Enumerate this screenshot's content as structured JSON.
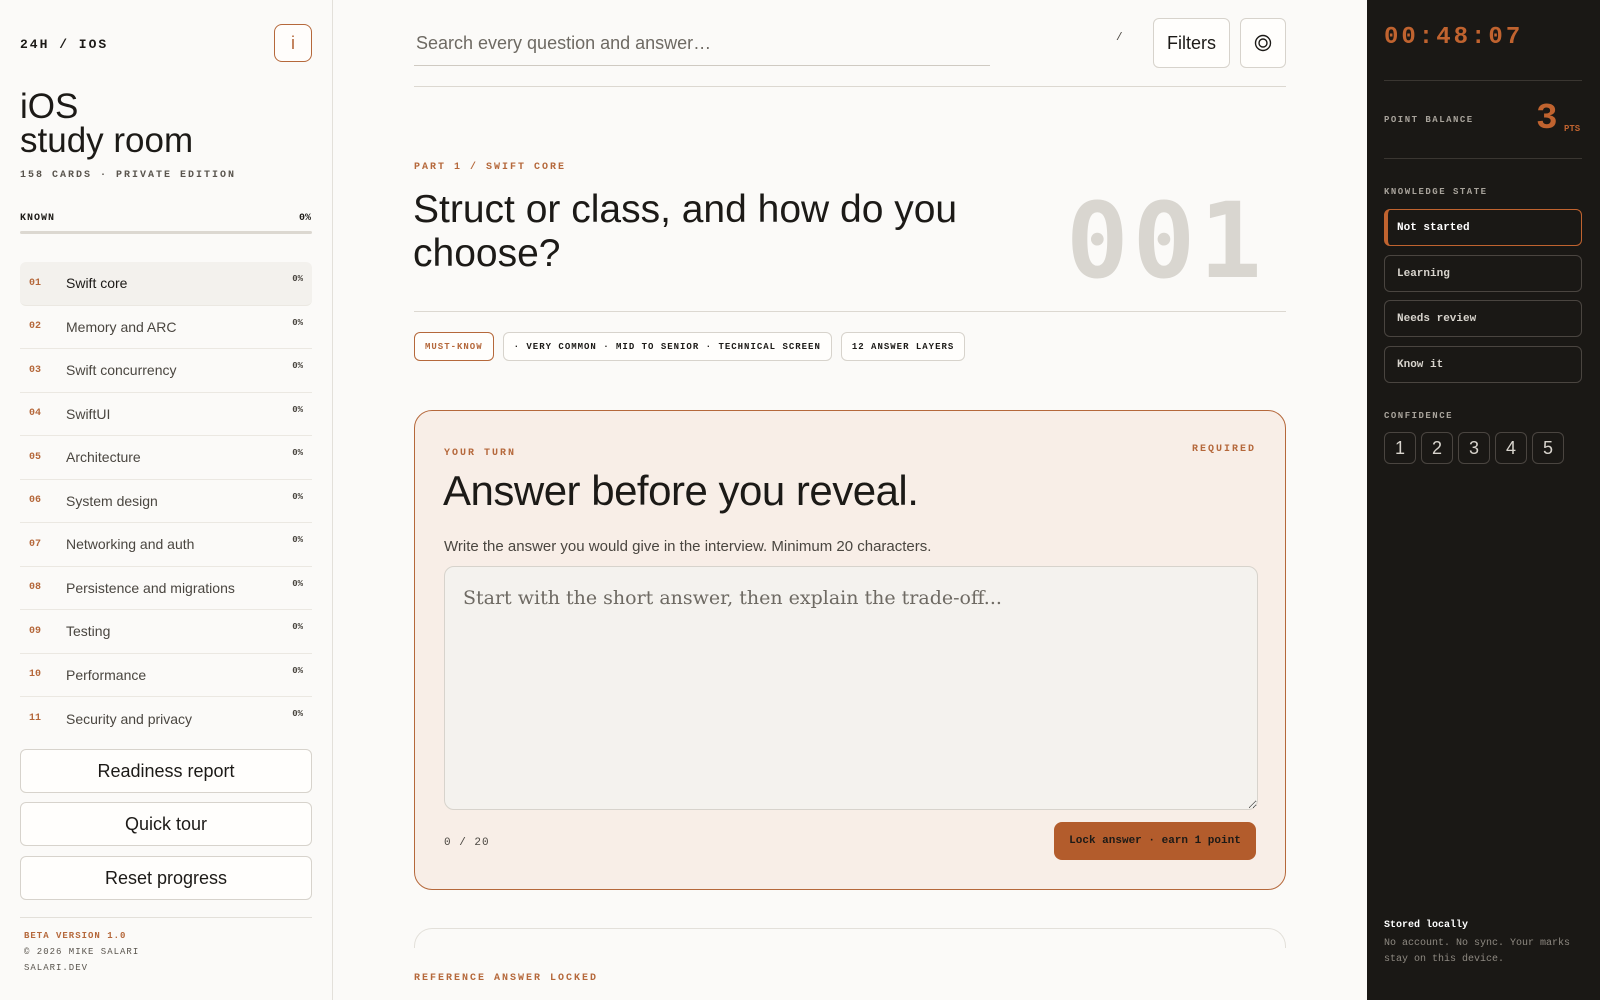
{
  "sidebar": {
    "brand": "24H / IOS",
    "info_label": "i",
    "title_line1": "iOS",
    "title_line2": "study room",
    "subtitle": "158 CARDS · PRIVATE EDITION",
    "known_label": "KNOWN",
    "known_value": "0%",
    "known_progress": 0,
    "topics": [
      {
        "num": "01",
        "label": "Swift core",
        "pct": "0%"
      },
      {
        "num": "02",
        "label": "Memory and ARC",
        "pct": "0%"
      },
      {
        "num": "03",
        "label": "Swift concurrency",
        "pct": "0%"
      },
      {
        "num": "04",
        "label": "SwiftUI",
        "pct": "0%"
      },
      {
        "num": "05",
        "label": "Architecture",
        "pct": "0%"
      },
      {
        "num": "06",
        "label": "System design",
        "pct": "0%"
      },
      {
        "num": "07",
        "label": "Networking and auth",
        "pct": "0%"
      },
      {
        "num": "08",
        "label": "Persistence and migrations",
        "pct": "0%"
      },
      {
        "num": "09",
        "label": "Testing",
        "pct": "0%"
      },
      {
        "num": "10",
        "label": "Performance",
        "pct": "0%"
      },
      {
        "num": "11",
        "label": "Security and privacy",
        "pct": "0%"
      }
    ],
    "buttons": {
      "readiness": "Readiness report",
      "tour": "Quick tour",
      "reset": "Reset progress"
    },
    "footer": {
      "version": "BETA VERSION 1.0",
      "copyright": "© 2026 MIKE SALARI",
      "site": "SALARI.DEV"
    }
  },
  "header": {
    "search_placeholder": "Search every question and answer…",
    "shortcut": "/",
    "filters_label": "Filters",
    "target_icon": "target-icon"
  },
  "question": {
    "part": "PART 1 / SWIFT CORE",
    "title": "Struct or class, and how do you choose?",
    "number": "001",
    "tags": {
      "must": "MUST-KNOW",
      "meta": "· VERY COMMON · MID TO SENIOR · TECHNICAL SCREEN",
      "layers": "12 ANSWER LAYERS"
    }
  },
  "answer_card": {
    "eyebrow": "YOUR TURN",
    "required": "REQUIRED",
    "title": "Answer before you reveal.",
    "description": "Write the answer you would give in the interview. Minimum 20 characters.",
    "placeholder": "Start with the short answer, then explain the trade-off...",
    "value": "",
    "counter": "0 / 20",
    "lock_label": "Lock answer · earn 1 point"
  },
  "reference": {
    "label": "REFERENCE ANSWER LOCKED"
  },
  "panel": {
    "timer": "00:48:07",
    "balance_label": "POINT BALANCE",
    "balance_value": "3",
    "balance_unit": "PTS",
    "knowledge_label": "KNOWLEDGE STATE",
    "states": [
      "Not started",
      "Learning",
      "Needs review",
      "Know it"
    ],
    "active_state": "Not started",
    "confidence_label": "CONFIDENCE",
    "confidence": [
      "1",
      "2",
      "3",
      "4",
      "5"
    ],
    "stored_title": "Stored locally",
    "stored_desc": "No account. No sync. Your marks stay on this device."
  },
  "colors": {
    "accent": "#b5683b",
    "panel_bg": "#1a1815",
    "page_bg": "#fbfaf8",
    "card_bg": "#f8eee7"
  }
}
